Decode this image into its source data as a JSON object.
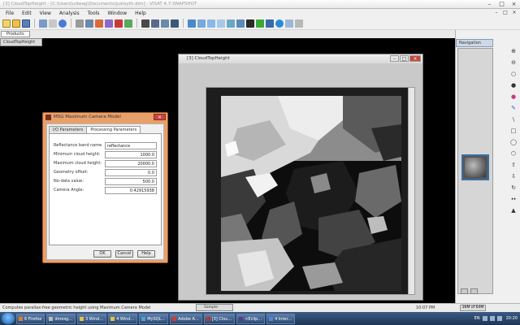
{
  "window": {
    "title": "[3] CloudTopHeight - [C:\\Users\\udwag\\Documents\\justsyth.dim] - VISAT 4.7-SNAPSHOT"
  },
  "menubar": {
    "items": [
      "File",
      "Edit",
      "View",
      "Analysis",
      "Tools",
      "Window",
      "Help"
    ]
  },
  "subtab": {
    "label": "Products"
  },
  "workspace": {
    "tab_label": "CloudTopHeight"
  },
  "image_window": {
    "title": "[3] CloudTopHeight"
  },
  "dialog": {
    "title": "MSG Maximum Camera Model",
    "tabs": [
      "I/O Parameters",
      "Processing Parameters"
    ],
    "params": [
      {
        "label": "Reflectance band name:",
        "value": "reflectance",
        "align": "left"
      },
      {
        "label": "Minimum cloud height:",
        "value": "1000.0",
        "align": "right"
      },
      {
        "label": "Maximum cloud height:",
        "value": "20000.0",
        "align": "right"
      },
      {
        "label": "Geometry offset:",
        "value": "0.0",
        "align": "right"
      },
      {
        "label": "No-data value:",
        "value": "500.0",
        "align": "right"
      },
      {
        "label": "Camera Angle:",
        "value": "0.42915938",
        "align": "right"
      }
    ],
    "buttons": {
      "ok": "OK",
      "cancel": "Cancel",
      "help": "Help"
    }
  },
  "right_panel": {
    "header": "Navigation"
  },
  "statusbar": {
    "text": "Computes parallax-free geometric height using Maximum Camera Model",
    "time": "10:07 PM",
    "memory": "36M of 64M",
    "minimized_label": "Sample"
  },
  "taskbar": {
    "items": [
      {
        "label": "6 Firefox",
        "color": "#e87a22"
      },
      {
        "label": "dmesg...",
        "color": "#bbbbbb"
      },
      {
        "label": "3 Wind...",
        "color": "#e8c23a"
      },
      {
        "label": "4 Wind...",
        "color": "#e8c23a"
      },
      {
        "label": "MySQL...",
        "color": "#4aa0d8"
      },
      {
        "label": "Adobe A...",
        "color": "#d83a2a"
      },
      {
        "label": "[3] Clou...",
        "color": "#b8382a"
      },
      {
        "label": "<Eclip...",
        "color": "#5a3a8a"
      },
      {
        "label": "4 Inter...",
        "color": "#4a8ad8"
      }
    ],
    "clock": "20:20",
    "lang": "EN"
  },
  "colors": {
    "dialog_frame": "#e8a06a",
    "taskbar": "#2d4c75",
    "close_button": "#c9463d"
  }
}
